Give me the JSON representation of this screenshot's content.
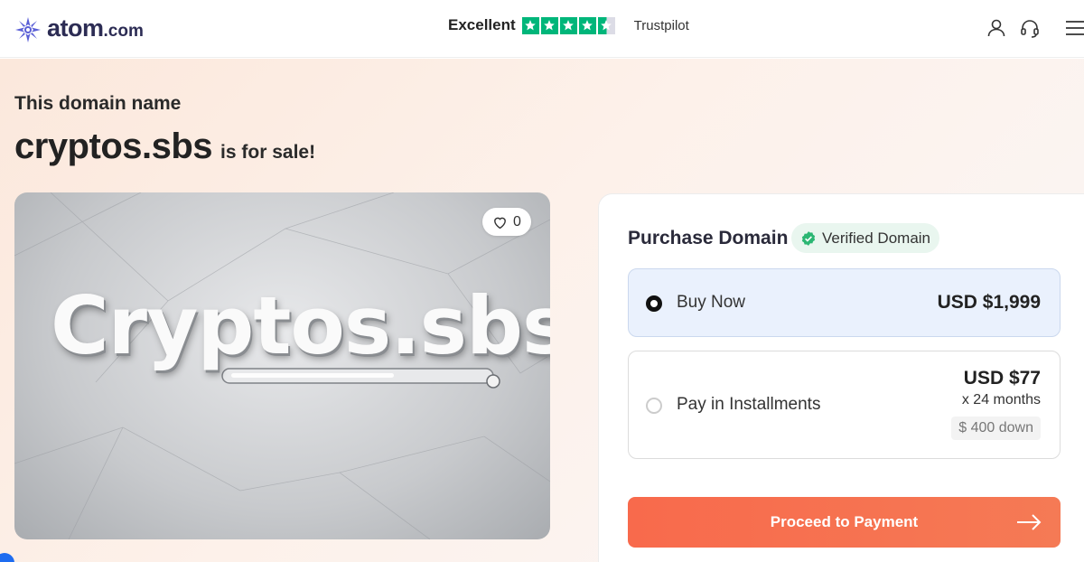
{
  "header": {
    "logo_text": "atom",
    "logo_suffix": ".com",
    "trust_label": "Excellent",
    "trust_brand": "Trustpilot",
    "trust_rating_stars": 4.5,
    "icons": [
      "user-icon",
      "headset-icon",
      "menu-icon"
    ]
  },
  "hero": {
    "subtitle": "This domain name",
    "domain": "cryptos.sbs",
    "for_sale": "is for sale!"
  },
  "image_card": {
    "like_count": "0"
  },
  "purchase": {
    "title": "Purchase Domain",
    "verified_label": "Verified Domain",
    "buy_now": {
      "label": "Buy Now",
      "price": "USD $1,999",
      "selected": true
    },
    "installments": {
      "label": "Pay in Installments",
      "price": "USD $77",
      "term": "x 24 months",
      "down": "$ 400 down",
      "selected": false
    },
    "proceed_label": "Proceed to Payment"
  },
  "colors": {
    "accent": "#f86a4c",
    "trustpilot_green": "#00b67a",
    "brand_navy": "#2c2c54",
    "selected_bg": "#eaf1fd"
  }
}
